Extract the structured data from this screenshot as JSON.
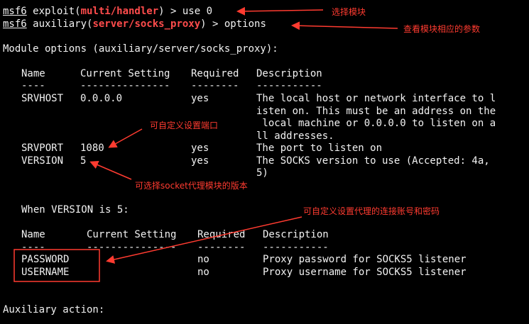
{
  "prompt": {
    "prefix": "msf6",
    "line1_pre": " exploit(",
    "line1_module": "multi/handler",
    "line1_post": ") > use 0",
    "line2_pre": " auxiliary(",
    "line2_module": "server/socks_proxy",
    "line2_post": ") > options"
  },
  "module_options_title": "Module options (auxiliary/server/socks_proxy):",
  "table1": {
    "headers": [
      "Name",
      "Current Setting",
      "Required",
      "Description"
    ],
    "dashes": [
      "----",
      "---------------",
      "--------",
      "-----------"
    ],
    "rows": [
      {
        "name": "SRVHOST",
        "value": "0.0.0.0",
        "required": "yes",
        "desc": [
          "The local host or network interface to l",
          "isten on. This must be an address on the",
          " local machine or 0.0.0.0 to listen on a",
          "ll addresses."
        ]
      },
      {
        "name": "SRVPORT",
        "value": "1080",
        "required": "yes",
        "desc": [
          "The port to listen on"
        ]
      },
      {
        "name": "VERSION",
        "value": "5",
        "required": "yes",
        "desc": [
          "The SOCKS version to use (Accepted: 4a,",
          "5)"
        ]
      }
    ]
  },
  "when_version": "When VERSION is 5:",
  "table2": {
    "headers": [
      "Name",
      "Current Setting",
      "Required",
      "Description"
    ],
    "dashes": [
      "----",
      "---------------",
      "--------",
      "-----------"
    ],
    "rows": [
      {
        "name": "PASSWORD",
        "value": "",
        "required": "no",
        "desc": "Proxy password for SOCKS5 listener"
      },
      {
        "name": "USERNAME",
        "value": "",
        "required": "no",
        "desc": "Proxy username for SOCKS5 listener"
      }
    ]
  },
  "aux_action": "Auxiliary action:",
  "annotations": {
    "select_module": "选择模块",
    "view_params": "查看模块相应的参数",
    "custom_port": "可自定义设置端口",
    "select_version": "可选择socket代理模块的版本",
    "custom_account": "可自定义设置代理的连接账号和密码"
  },
  "colors": {
    "annotation": "#ff3b30",
    "module": "#ff4c4c",
    "background": "#000000",
    "text": "#f2f2f2"
  }
}
